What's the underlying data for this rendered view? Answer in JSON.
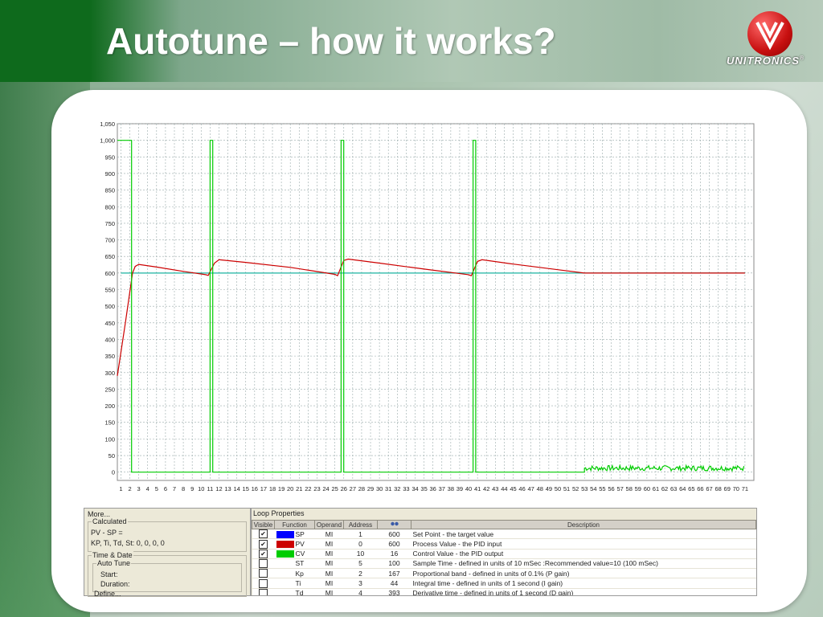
{
  "slide": {
    "title": "Autotune – how it works?"
  },
  "logo": {
    "text": "UNITRONICS",
    "trademark": "®"
  },
  "colors": {
    "sp": "#0000ff",
    "pv": "#cc0000",
    "cv": "#00cc00",
    "sp_line": "#1ab3a0"
  },
  "chart_data": {
    "type": "line",
    "y_ticks": [
      0,
      50,
      100,
      150,
      200,
      250,
      300,
      350,
      400,
      450,
      500,
      550,
      600,
      650,
      700,
      750,
      800,
      850,
      900,
      950,
      1000,
      1050
    ],
    "ylim": [
      -25,
      1050
    ],
    "x_ticks": [
      1,
      2,
      3,
      4,
      5,
      6,
      7,
      8,
      9,
      10,
      11,
      12,
      13,
      14,
      15,
      16,
      17,
      18,
      19,
      20,
      21,
      22,
      23,
      24,
      25,
      26,
      27,
      28,
      29,
      30,
      31,
      32,
      33,
      34,
      35,
      36,
      37,
      38,
      39,
      40,
      41,
      42,
      43,
      44,
      45,
      46,
      47,
      48,
      49,
      50,
      51,
      52,
      53,
      54,
      55,
      56,
      57,
      58,
      59,
      60,
      61,
      62,
      63,
      64,
      65,
      66,
      67,
      68,
      69,
      70,
      71
    ],
    "xlim": [
      0.6,
      72
    ],
    "grid": true,
    "series": [
      {
        "name": "SP",
        "color": "#1ab3a0",
        "x": [
          1,
          71
        ],
        "y": [
          600,
          600
        ]
      },
      {
        "name": "PV",
        "color": "#cc0000",
        "x": [
          0.6,
          1.5,
          2.3,
          2.6,
          3,
          5,
          8,
          10.5,
          10.8,
          11.5,
          12,
          15,
          20,
          25,
          25.3,
          26,
          26.5,
          30,
          35,
          40,
          40.3,
          41,
          41.5,
          45,
          50,
          53,
          60,
          71
        ],
        "y": [
          290,
          450,
          600,
          620,
          626,
          618,
          605,
          595,
          593,
          630,
          640,
          632,
          617,
          596,
          592,
          638,
          642,
          630,
          612,
          595,
          592,
          635,
          640,
          627,
          610,
          600,
          600,
          600
        ]
      },
      {
        "name": "CV",
        "color": "#00cc00",
        "x": [
          0.6,
          2.2,
          2.2,
          11,
          11,
          11.3,
          11.3,
          25.7,
          25.7,
          26,
          26,
          40.5,
          40.5,
          40.8,
          40.8,
          53
        ],
        "y": [
          1000,
          1000,
          0,
          0,
          1000,
          1000,
          0,
          0,
          1000,
          1000,
          0,
          0,
          1000,
          1000,
          0,
          0
        ],
        "noise_tail": {
          "x_start": 53,
          "x_end": 71,
          "mean": 12,
          "amplitude": 8
        }
      }
    ]
  },
  "left_panel": {
    "header": "More...",
    "calculated_label": "Calculated",
    "pv_sp": "PV - SP =",
    "kp_ti_td_st": "KP, Ti, Td, St:  0, 0, 0, 0",
    "time_date_label": "Time & Date",
    "auto_tune_label": "Auto Tune",
    "start_label": "Start:",
    "duration_label": "Duration:",
    "define_label": "Define..."
  },
  "loop_properties": {
    "header": "Loop Properties",
    "columns": [
      "Visible",
      "Function",
      "Operand",
      "Address",
      "",
      "Description"
    ],
    "rows": [
      {
        "checked": true,
        "swatch": "#0000ff",
        "function": "SP",
        "operand": "MI",
        "address": "1",
        "value": "600",
        "description": "Set Point - the target value"
      },
      {
        "checked": true,
        "swatch": "#cc0000",
        "function": "PV",
        "operand": "MI",
        "address": "0",
        "value": "600",
        "description": "Process Value - the PID input"
      },
      {
        "checked": true,
        "swatch": "#00cc00",
        "function": "CV",
        "operand": "MI",
        "address": "10",
        "value": "16",
        "description": "Control Value - the PID output"
      },
      {
        "checked": false,
        "swatch": "",
        "function": "ST",
        "operand": "MI",
        "address": "5",
        "value": "100",
        "description": "Sample Time - defined in units of 10 mSec :Recommended value=10 (100 mSec)"
      },
      {
        "checked": false,
        "swatch": "",
        "function": "Kp",
        "operand": "MI",
        "address": "2",
        "value": "167",
        "description": "Proportional band - defined in units of 0.1% (P gain)"
      },
      {
        "checked": false,
        "swatch": "",
        "function": "Ti",
        "operand": "MI",
        "address": "3",
        "value": "44",
        "description": "Integral time - defined in units of 1 second (I gain)"
      },
      {
        "checked": false,
        "swatch": "",
        "function": "Td",
        "operand": "MI",
        "address": "4",
        "value": "393",
        "description": "Derivative time - defined in units of 1 second (D gain)"
      }
    ]
  }
}
